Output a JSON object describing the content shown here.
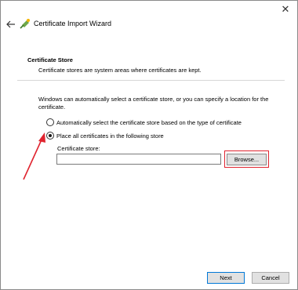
{
  "window": {
    "close_glyph": "✕",
    "title": "Certificate Import Wizard"
  },
  "section": {
    "title": "Certificate Store",
    "description": "Certificate stores are system areas where certificates are kept."
  },
  "intro_text": "Windows can automatically select a certificate store, or you can specify a location for the certificate.",
  "options": {
    "auto_label": "Automatically select the certificate store based on the type of certificate",
    "auto_selected": false,
    "place_label": "Place all certificates in the following store",
    "place_selected": true
  },
  "store": {
    "label": "Certificate store:",
    "value": "",
    "browse_label": "Browse..."
  },
  "footer": {
    "next_label": "Next",
    "cancel_label": "Cancel"
  },
  "colors": {
    "annotation_red": "#e0242f",
    "primary_button_border": "#0078d7"
  },
  "icons": {
    "back": "back-arrow-icon",
    "close": "close-icon",
    "wizard": "certificate-wizard-icon"
  }
}
